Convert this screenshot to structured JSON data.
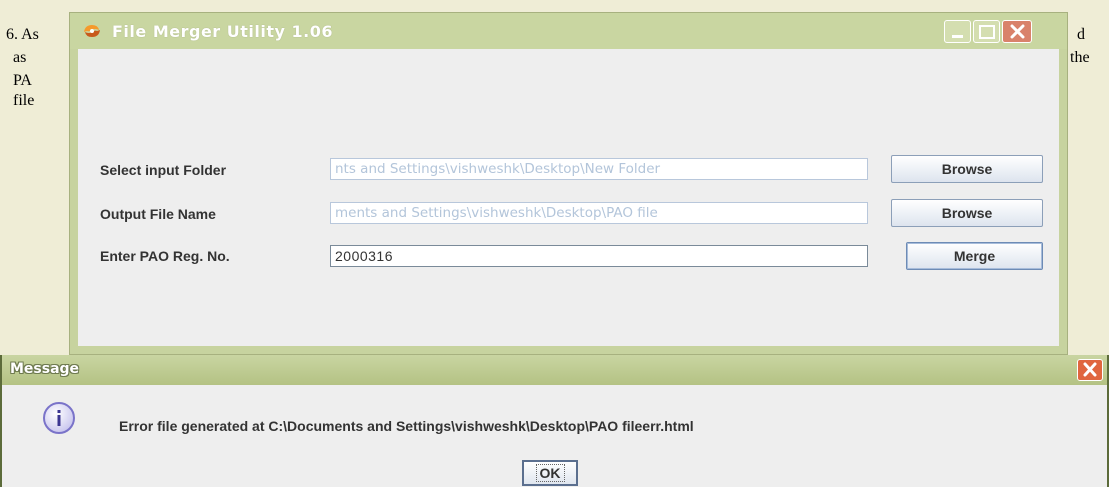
{
  "document": {
    "lines_left": [
      "6. As",
      "as",
      "PA",
      "file"
    ],
    "lines_right": [
      "d",
      "the"
    ]
  },
  "window": {
    "title": "File Merger Utility 1.06",
    "controls": [
      "minimize-icon",
      "maximize-icon",
      "close-icon"
    ]
  },
  "form": {
    "input_folder": {
      "label": "Select input Folder",
      "value": "nts and Settings\\vishweshk\\Desktop\\New Folder",
      "button": "Browse"
    },
    "output_file": {
      "label": "Output File Name",
      "value": "ments and Settings\\vishweshk\\Desktop\\PAO file",
      "button": "Browse"
    },
    "pao_reg": {
      "label": "Enter PAO Reg. No.",
      "value": "2000316",
      "button": "Merge"
    }
  },
  "message": {
    "title": "Message",
    "icon": "info-icon",
    "text": "Error file generated at C:\\Documents and Settings\\vishweshk\\Desktop\\PAO fileerr.html",
    "ok_label": "OK"
  },
  "colors": {
    "title_bar": "#c9d6a1",
    "close_button": "#e0663f",
    "field_border": "#b8c7db",
    "disabled_text": "#b3c5da"
  }
}
